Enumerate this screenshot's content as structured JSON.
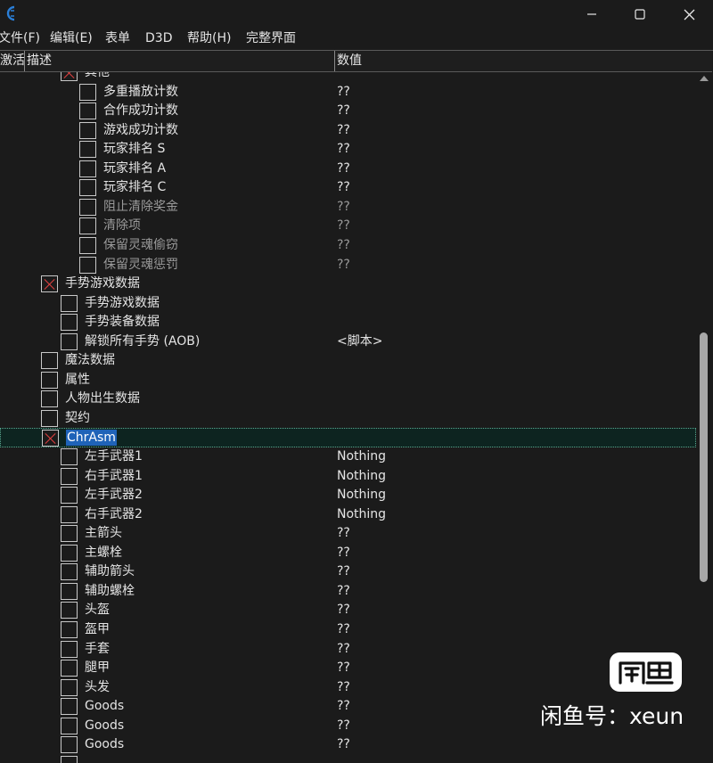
{
  "window": {
    "icon": "cheat-engine-logo",
    "minimize_icon": "minimize-icon",
    "maximize_icon": "maximize-icon",
    "close_icon": "close-icon"
  },
  "menu": [
    "文件(F)",
    "编辑(E)",
    "表单",
    "D3D",
    "帮助(H)",
    "完整界面"
  ],
  "columns": {
    "active": "激活",
    "description": "描述",
    "value": "数值"
  },
  "rows": [
    {
      "desc": "其他",
      "value": "",
      "checked": true,
      "level": 2,
      "dim": false
    },
    {
      "desc": "多重播放计数",
      "value": "??",
      "checked": false,
      "level": 3,
      "dim": false
    },
    {
      "desc": "合作成功计数",
      "value": "??",
      "checked": false,
      "level": 3,
      "dim": false
    },
    {
      "desc": "游戏成功计数",
      "value": "??",
      "checked": false,
      "level": 3,
      "dim": false
    },
    {
      "desc": "玩家排名 S",
      "value": "??",
      "checked": false,
      "level": 3,
      "dim": false
    },
    {
      "desc": "玩家排名 A",
      "value": "??",
      "checked": false,
      "level": 3,
      "dim": false
    },
    {
      "desc": "玩家排名 C",
      "value": "??",
      "checked": false,
      "level": 3,
      "dim": false
    },
    {
      "desc": "阻止清除奖金",
      "value": "??",
      "checked": false,
      "level": 3,
      "dim": true
    },
    {
      "desc": "清除项",
      "value": "??",
      "checked": false,
      "level": 3,
      "dim": true
    },
    {
      "desc": "保留灵魂偷窃",
      "value": "??",
      "checked": false,
      "level": 3,
      "dim": true
    },
    {
      "desc": "保留灵魂惩罚",
      "value": "??",
      "checked": false,
      "level": 3,
      "dim": true
    },
    {
      "desc": "手势游戏数据",
      "value": "",
      "checked": true,
      "level": 1,
      "dim": false
    },
    {
      "desc": "手势游戏数据",
      "value": "",
      "checked": false,
      "level": 2,
      "dim": false
    },
    {
      "desc": "手势装备数据",
      "value": "",
      "checked": false,
      "level": 2,
      "dim": false
    },
    {
      "desc": "解锁所有手势 (AOB)",
      "value": "<脚本>",
      "checked": false,
      "level": 2,
      "dim": false
    },
    {
      "desc": "魔法数据",
      "value": "",
      "checked": false,
      "level": 1,
      "dim": false
    },
    {
      "desc": "属性",
      "value": "",
      "checked": false,
      "level": 1,
      "dim": false
    },
    {
      "desc": "人物出生数据",
      "value": "",
      "checked": false,
      "level": 1,
      "dim": false
    },
    {
      "desc": "契约",
      "value": "",
      "checked": false,
      "level": 1,
      "dim": false
    },
    {
      "desc": "ChrAsm",
      "value": "",
      "checked": true,
      "level": 1,
      "dim": false,
      "selected": true
    },
    {
      "desc": "左手武器1",
      "value": "Nothing",
      "checked": false,
      "level": 2,
      "dim": false
    },
    {
      "desc": "右手武器1",
      "value": "Nothing",
      "checked": false,
      "level": 2,
      "dim": false
    },
    {
      "desc": "左手武器2",
      "value": "Nothing",
      "checked": false,
      "level": 2,
      "dim": false
    },
    {
      "desc": "右手武器2",
      "value": "Nothing",
      "checked": false,
      "level": 2,
      "dim": false
    },
    {
      "desc": "主箭头",
      "value": "??",
      "checked": false,
      "level": 2,
      "dim": false
    },
    {
      "desc": "主螺栓",
      "value": "??",
      "checked": false,
      "level": 2,
      "dim": false
    },
    {
      "desc": "辅助箭头",
      "value": "??",
      "checked": false,
      "level": 2,
      "dim": false
    },
    {
      "desc": "辅助螺栓",
      "value": "??",
      "checked": false,
      "level": 2,
      "dim": false
    },
    {
      "desc": "头盔",
      "value": "??",
      "checked": false,
      "level": 2,
      "dim": false
    },
    {
      "desc": "盔甲",
      "value": "??",
      "checked": false,
      "level": 2,
      "dim": false
    },
    {
      "desc": "手套",
      "value": "??",
      "checked": false,
      "level": 2,
      "dim": false
    },
    {
      "desc": "腿甲",
      "value": "??",
      "checked": false,
      "level": 2,
      "dim": false
    },
    {
      "desc": "头发",
      "value": "??",
      "checked": false,
      "level": 2,
      "dim": false
    },
    {
      "desc": "Goods",
      "value": "??",
      "checked": false,
      "level": 2,
      "dim": false
    },
    {
      "desc": "Goods",
      "value": "??",
      "checked": false,
      "level": 2,
      "dim": false
    },
    {
      "desc": "Goods",
      "value": "??",
      "checked": false,
      "level": 2,
      "dim": false
    },
    {
      "desc": "",
      "value": "",
      "checked": false,
      "level": 2,
      "dim": false
    }
  ],
  "watermark": {
    "badge": "闲鱼",
    "text": "闲鱼号：xeun"
  },
  "colors": {
    "background": "#1b1b1b",
    "text": "#e4e4e4",
    "check_mark": "#e04040",
    "selection": "#1f63b8"
  }
}
